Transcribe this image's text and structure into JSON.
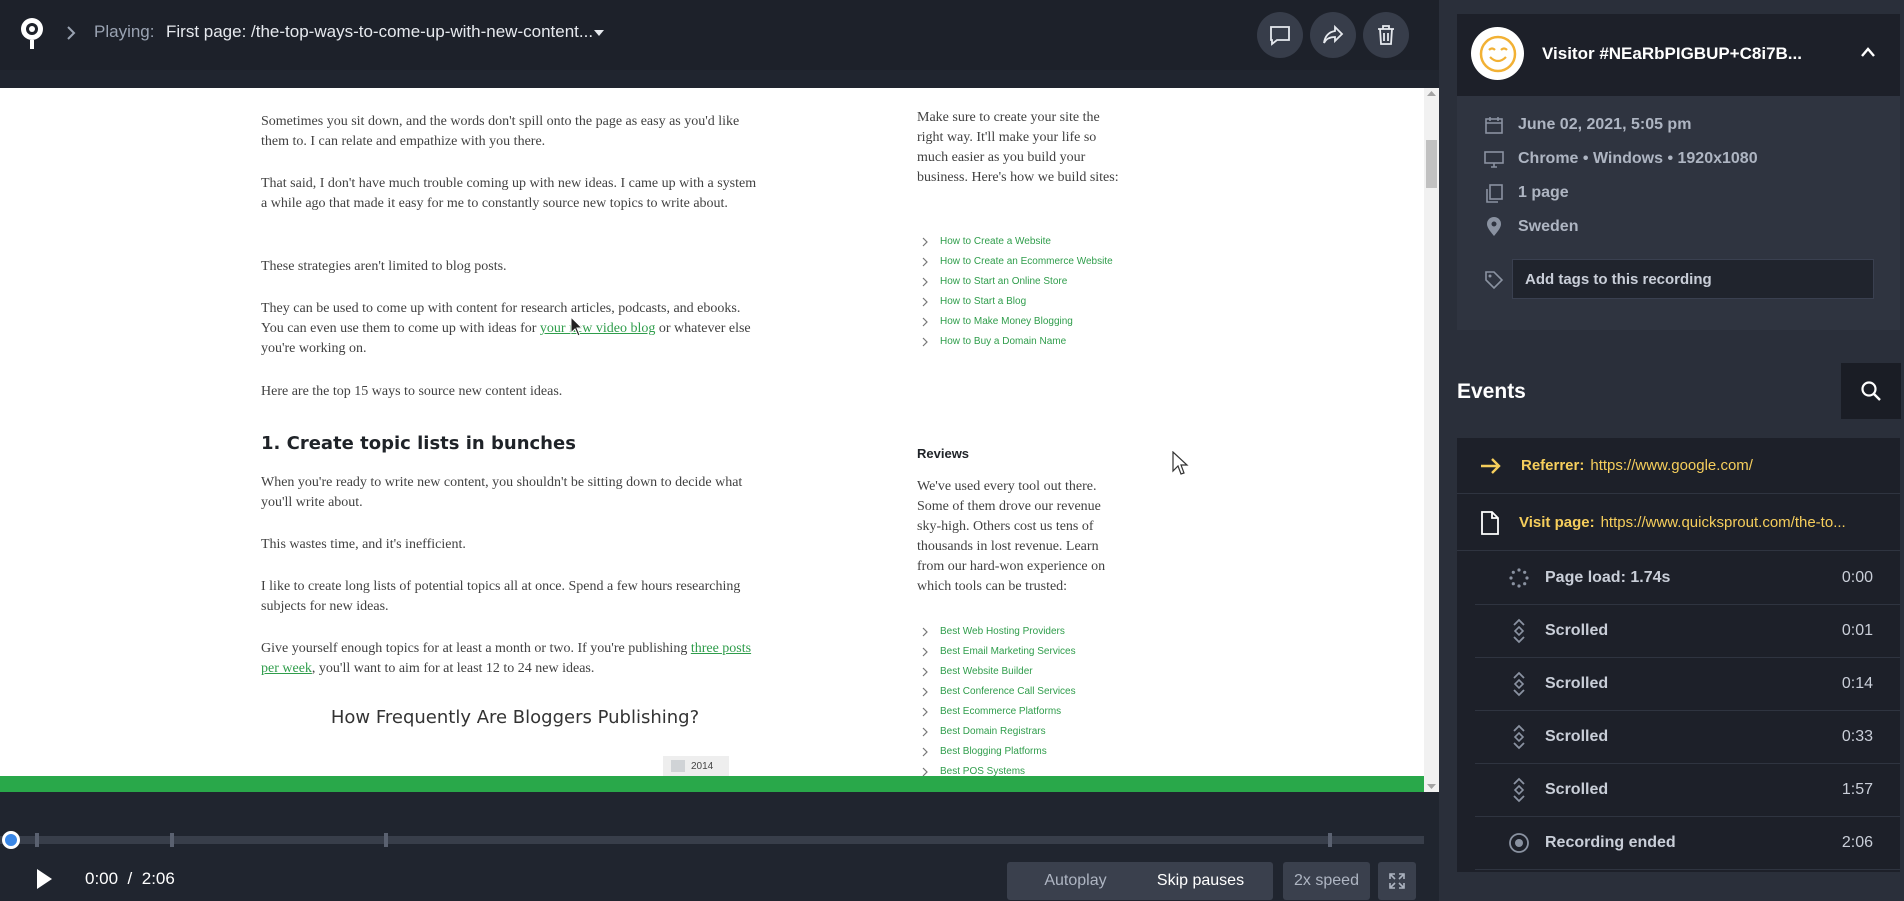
{
  "header": {
    "playing_label": "Playing:",
    "page_title": "First page: /the-top-ways-to-come-up-with-new-content...",
    "icons": [
      "logo-icon",
      "chevron-right-icon",
      "caret-down-icon",
      "comment-icon",
      "share-icon",
      "trash-icon"
    ]
  },
  "article": {
    "p1": "Sometimes you sit down, and the words don't spill onto the page as easy as you'd like them to. I can relate and empathize with you there.",
    "p2": "That said, I don't have much trouble coming up with new ideas. I came up with a system a while ago that made it easy for me to constantly source new topics to write about.",
    "p3": "These strategies aren't limited to blog posts.",
    "p4_before": "They can be used to come up with content for research articles, podcasts, and ebooks. You can even use them to come up with ideas for ",
    "p4_link": "your new video blog",
    "p4_after": " or whatever else you're working on.",
    "p5": "Here are the top 15 ways to source new content ideas.",
    "heading": "1. Create topic lists in bunches",
    "p6": "When you're ready to write new content, you shouldn't be sitting down to decide what you'll write about.",
    "p7": "This wastes time, and it's inefficient.",
    "p8": "I like to create long lists of potential topics all at once. Spend a few hours researching subjects for new ideas.",
    "p9_before": "Give yourself enough topics for at least a month or two. If you're publishing ",
    "p9_link": "three posts per week",
    "p9_after": ", you'll want to aim for at least 12 to 24 new ideas.",
    "chart_title": "How Frequently Are Bloggers Publishing?",
    "chart_legend": "2014"
  },
  "sidebar": {
    "intro": "Make sure to create your site the right way. It'll make your life so much easier as you build your business. Here's how we build sites:",
    "guides": [
      "How to Create a Website",
      "How to Create an Ecommerce Website",
      "How to Start an Online Store",
      "How to Start a Blog",
      "How to Make Money Blogging",
      "How to Buy a Domain Name"
    ],
    "reviews_heading": "Reviews",
    "reviews_intro": "We've used every tool out there. Some of them drove our revenue sky-high. Others cost us tens of thousands in lost revenue. Learn from our hard-won experience on which tools can be trusted:",
    "reviews": [
      "Best Web Hosting Providers",
      "Best Email Marketing Services",
      "Best Website Builder",
      "Best Conference Call Services",
      "Best Ecommerce Platforms",
      "Best Domain Registrars",
      "Best Blogging Platforms",
      "Best POS Systems"
    ]
  },
  "player": {
    "current_time": "0:00",
    "separator": "/",
    "total_time": "2:06",
    "autoplay": "Autoplay",
    "skip_pauses": "Skip pauses",
    "speed": "2x speed",
    "progress": 0.0,
    "page_scroll_progress": 1.0,
    "accent": "#3a87e6",
    "scroll_bar_color": "#29a84a"
  },
  "visitor": {
    "name": "Visitor #NEaRbPIGBUP+C8i7B...",
    "date": "June 02, 2021, 5:05 pm",
    "device": "Chrome • Windows • 1920x1080",
    "pages": "1 page",
    "location": "Sweden",
    "tags_placeholder": "Add tags to this recording"
  },
  "events": {
    "title": "Events",
    "referrer_label": "Referrer:",
    "referrer_value": "https://www.google.com/",
    "visit_label": "Visit page:",
    "visit_value": "https://www.quicksprout.com/the-to...",
    "items": [
      {
        "label": "Page load: 1.74s",
        "time": "0:00",
        "icon": "spinner-icon"
      },
      {
        "label": "Scrolled",
        "time": "0:01",
        "icon": "scroll-icon"
      },
      {
        "label": "Scrolled",
        "time": "0:14",
        "icon": "scroll-icon"
      },
      {
        "label": "Scrolled",
        "time": "0:33",
        "icon": "scroll-icon"
      },
      {
        "label": "Scrolled",
        "time": "1:57",
        "icon": "scroll-icon"
      },
      {
        "label": "Recording ended",
        "time": "2:06",
        "icon": "stop-icon"
      }
    ],
    "accent": "#f6ce5c"
  }
}
